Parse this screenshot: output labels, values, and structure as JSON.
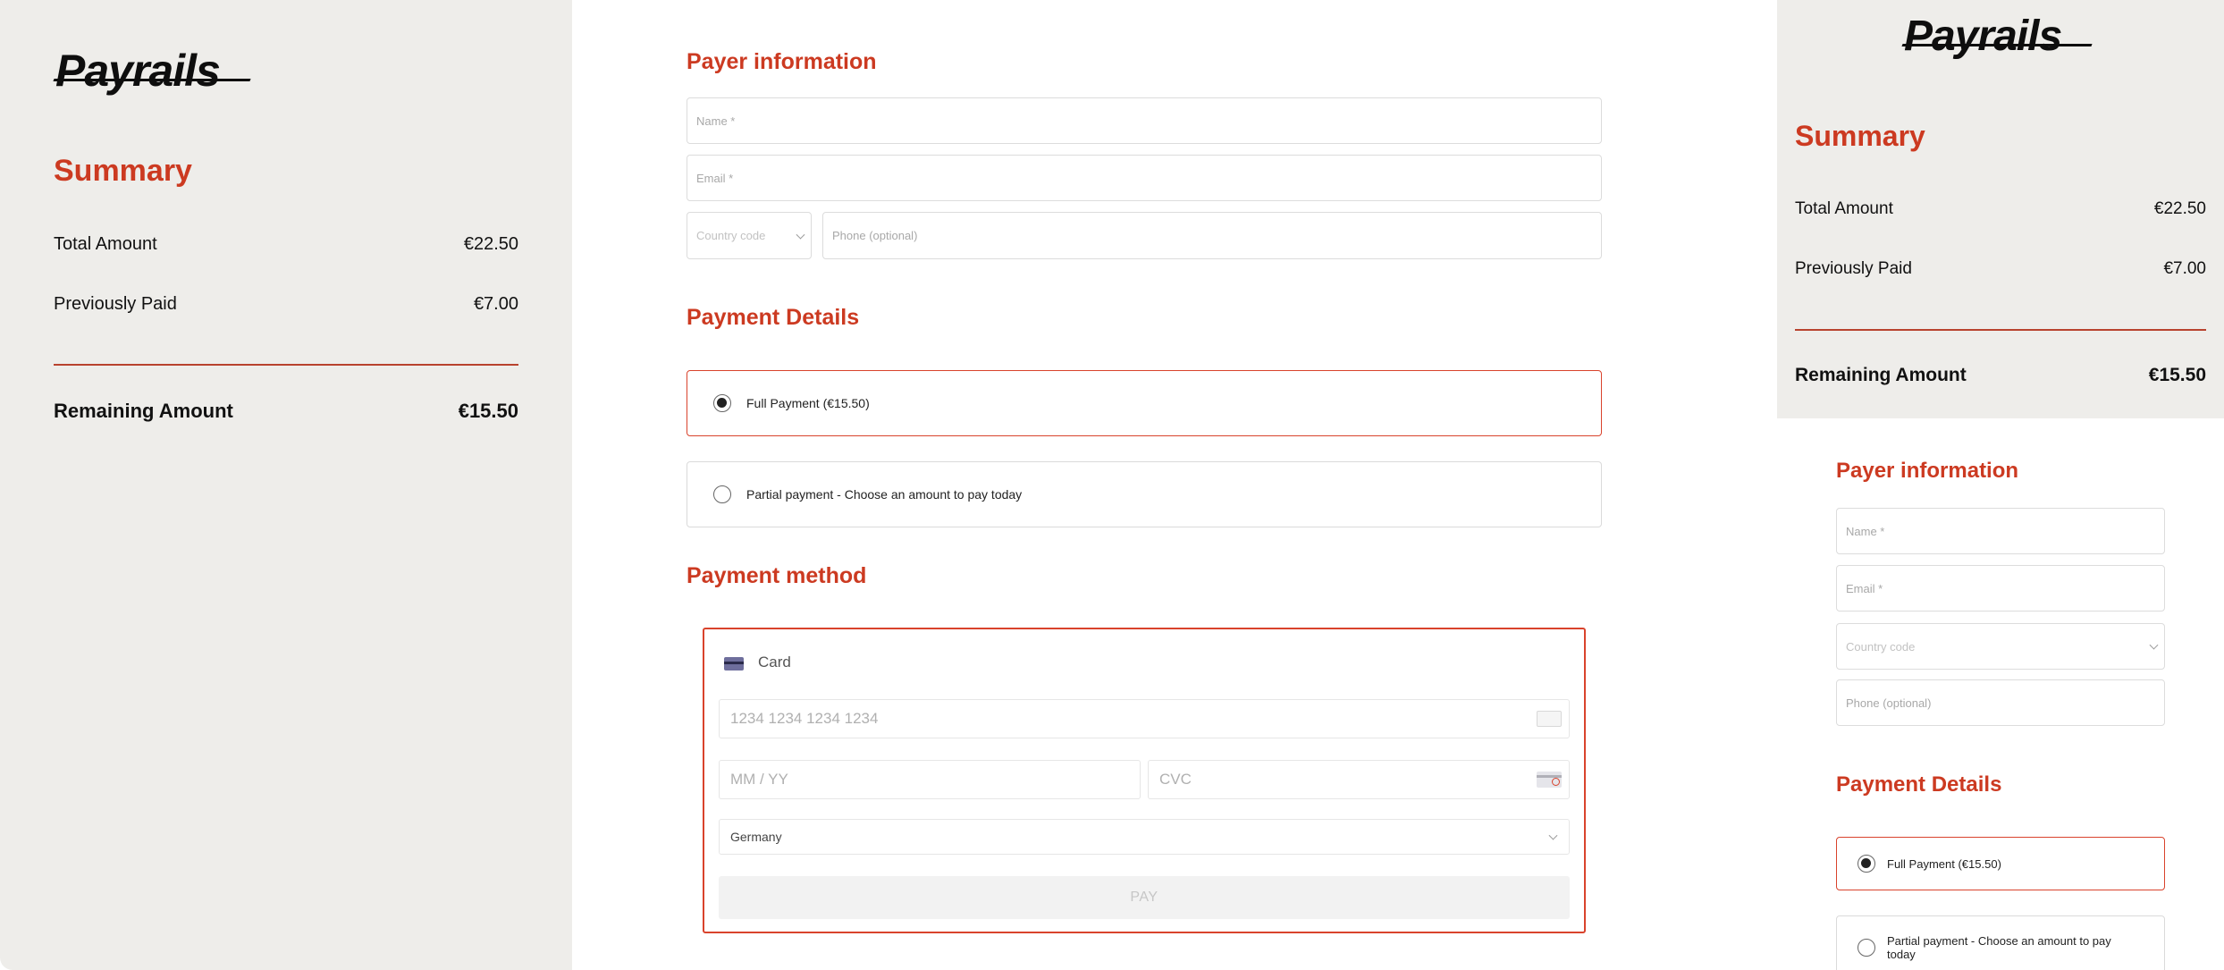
{
  "brand": {
    "logo_text": "Payrails",
    "accent_color": "#cc3a21",
    "sidebar_bg": "#eeedea"
  },
  "summary": {
    "title": "Summary",
    "total_label": "Total Amount",
    "total_value": "€22.50",
    "paid_label": "Previously Paid",
    "paid_value": "€7.00",
    "remaining_label": "Remaining Amount",
    "remaining_value": "€15.50"
  },
  "payer": {
    "title": "Payer information",
    "name_placeholder": "Name *",
    "email_placeholder": "Email *",
    "country_placeholder": "Country code",
    "phone_placeholder": "Phone (optional)"
  },
  "payment_details": {
    "title": "Payment Details",
    "options": [
      {
        "label": "Full Payment (€15.50)",
        "selected": true
      },
      {
        "label": "Partial payment - Choose an amount to pay today",
        "selected": false
      }
    ]
  },
  "payment_method": {
    "title": "Payment method",
    "card_label": "Card",
    "card_number_placeholder": "1234 1234 1234 1234",
    "expiry_placeholder": "MM / YY",
    "cvc_placeholder": "CVC",
    "country_value": "Germany",
    "pay_label": "PAY"
  }
}
